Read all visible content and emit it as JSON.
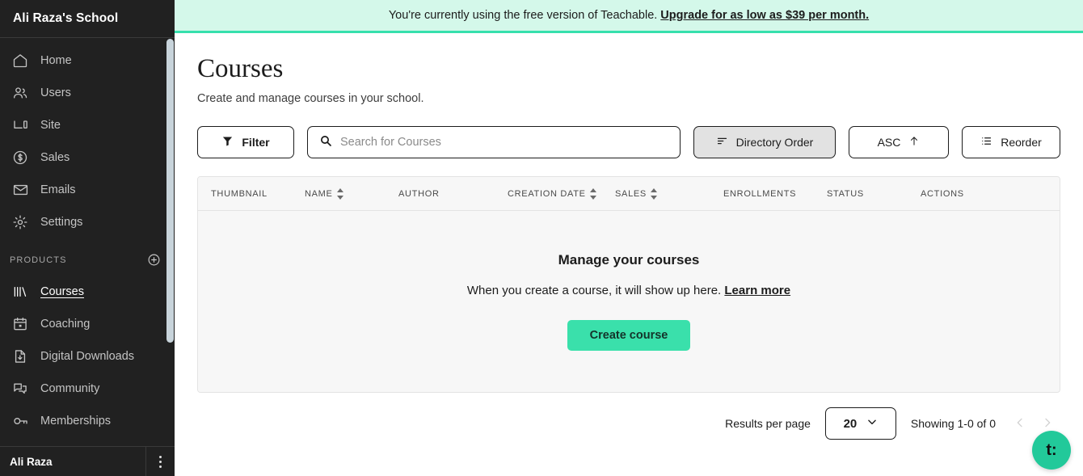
{
  "sidebar": {
    "school_name": "Ali Raza's School",
    "main_items": [
      {
        "label": "Home",
        "icon": "home-icon"
      },
      {
        "label": "Users",
        "icon": "users-icon"
      },
      {
        "label": "Site",
        "icon": "site-icon"
      },
      {
        "label": "Sales",
        "icon": "dollar-circle-icon"
      },
      {
        "label": "Emails",
        "icon": "envelope-icon"
      },
      {
        "label": "Settings",
        "icon": "gear-icon"
      }
    ],
    "products_section_label": "PRODUCTS",
    "add_product_icon": "plus-circle-icon",
    "product_items": [
      {
        "label": "Courses",
        "icon": "books-icon",
        "active": true
      },
      {
        "label": "Coaching",
        "icon": "calendar-icon",
        "active": false
      },
      {
        "label": "Digital Downloads",
        "icon": "file-download-icon",
        "active": false
      },
      {
        "label": "Community",
        "icon": "chat-bubbles-icon",
        "active": false
      },
      {
        "label": "Memberships",
        "icon": "key-icon",
        "active": false
      }
    ],
    "user_name": "Ali Raza",
    "user_menu_icon": "kebab-menu-icon"
  },
  "banner": {
    "text": "You're currently using the free version of Teachable.",
    "link": "Upgrade for as low as $39 per month."
  },
  "page": {
    "title": "Courses",
    "subtitle": "Create and manage courses in your school."
  },
  "toolbar": {
    "filter_label": "Filter",
    "filter_icon": "funnel-icon",
    "search_placeholder": "Search for Courses",
    "search_value": "",
    "search_icon": "search-icon",
    "directory_order_label": "Directory Order",
    "directory_order_icon": "sort-lines-icon",
    "asc_label": "ASC",
    "asc_icon": "arrow-up-icon",
    "reorder_label": "Reorder",
    "reorder_icon": "list-icon"
  },
  "table": {
    "columns": [
      {
        "label": "THUMBNAIL",
        "sortable": false
      },
      {
        "label": "NAME",
        "sortable": true
      },
      {
        "label": "AUTHOR",
        "sortable": false
      },
      {
        "label": "CREATION DATE",
        "sortable": true
      },
      {
        "label": "SALES",
        "sortable": true
      },
      {
        "label": "ENROLLMENTS",
        "sortable": false
      },
      {
        "label": "STATUS",
        "sortable": false
      },
      {
        "label": "ACTIONS",
        "sortable": false
      }
    ],
    "rows": [],
    "empty_state": {
      "title": "Manage your courses",
      "description": "When you create a course, it will show up here.",
      "learn_more": "Learn more",
      "create_button": "Create course"
    }
  },
  "pagination": {
    "results_per_page_label": "Results per page",
    "results_per_page_value": "20",
    "showing": "Showing 1-0 of 0",
    "prev_icon": "chevron-left-icon",
    "next_icon": "chevron-right-icon"
  },
  "fab": {
    "label": "t:"
  },
  "colors": {
    "sidebar_bg": "#212121",
    "banner_bg": "#d4f8ea",
    "banner_border": "#36e0ad",
    "accent_green": "#3ae0ab",
    "fab_green": "#22c99a",
    "table_bg": "#f7f7f7",
    "active_button_bg": "#e2e2e2"
  }
}
